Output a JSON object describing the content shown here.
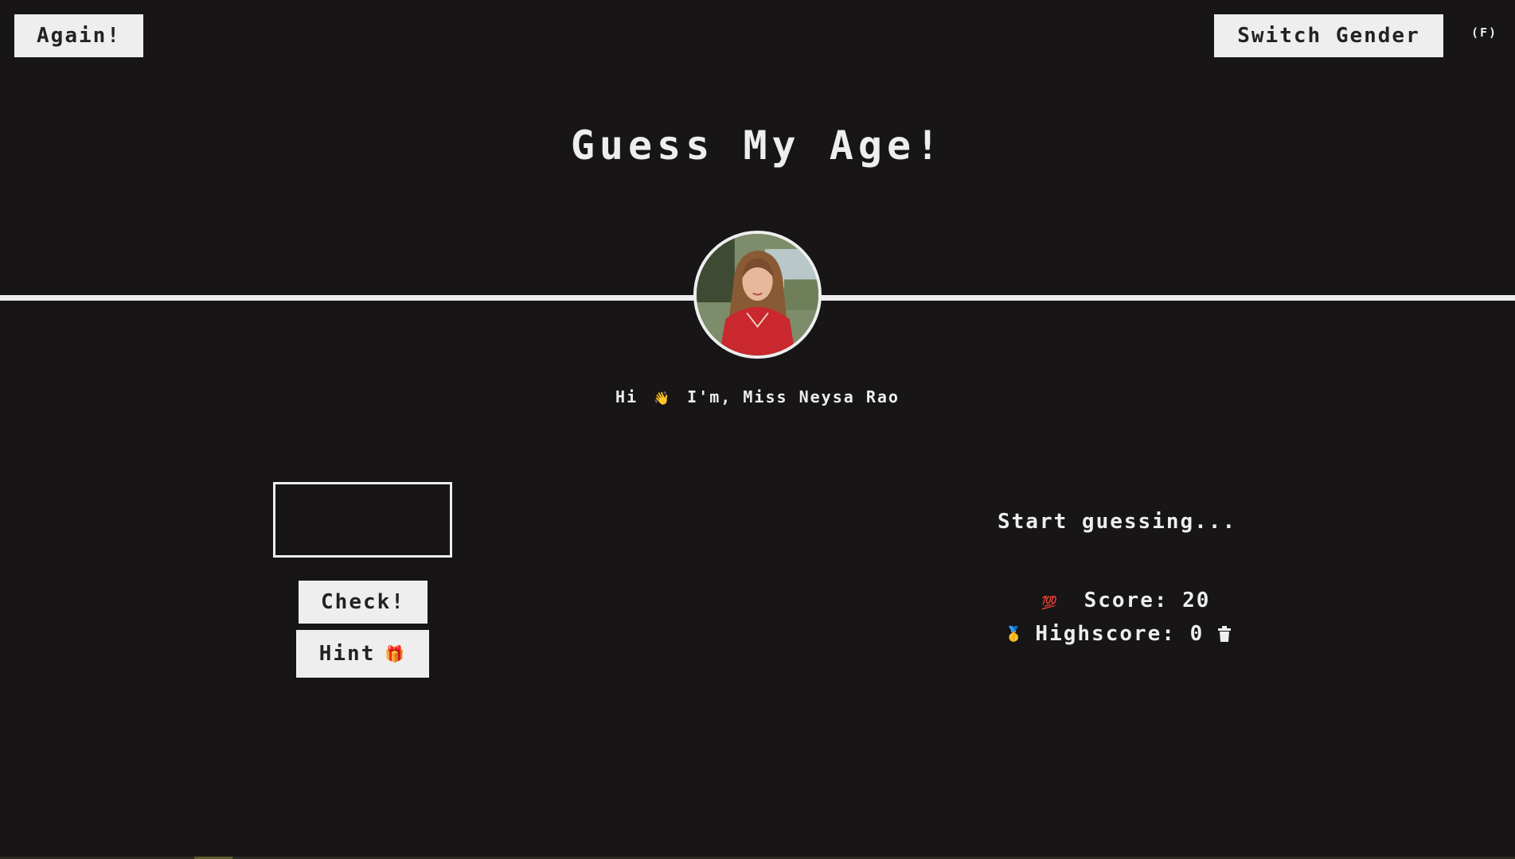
{
  "header": {
    "again_label": "Again!",
    "switch_label": "Switch Gender",
    "gender_tag": "(F)"
  },
  "title": "Guess My Age!",
  "profile": {
    "greeting_prefix": "Hi",
    "wave_icon": "👋",
    "greeting_suffix": "I'm, Miss Neysa Rao"
  },
  "controls": {
    "guess_value": "",
    "check_label": "Check!",
    "hint_label": "Hint",
    "hint_icon": "🎁"
  },
  "status": {
    "message": "Start guessing...",
    "score_icon": "💯",
    "score_label": "Score:",
    "score_value": "20",
    "highscore_icon": "🥇",
    "highscore_label": "Highscore:",
    "highscore_value": "0"
  },
  "colors": {
    "background": "#171515",
    "foreground": "#eeeeee"
  }
}
